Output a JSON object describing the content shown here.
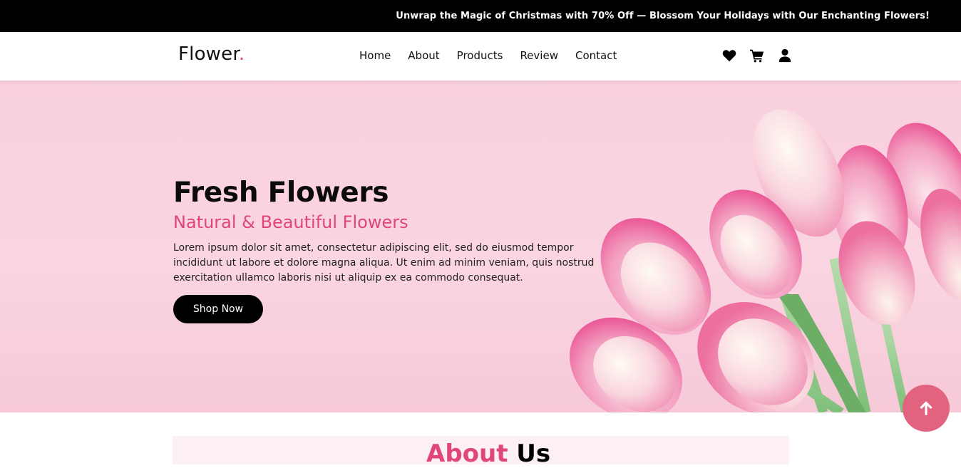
{
  "announcement": "Unwrap the Magic of Christmas with 70% Off — Blossom Your Holidays with Our Enchanting Flowers!",
  "brand": {
    "name": "Flower",
    "dot": ".",
    "accent_color": "#e0457b"
  },
  "nav": {
    "links": [
      "Home",
      "About",
      "Products",
      "Review",
      "Contact"
    ],
    "icons": [
      "heart-icon",
      "cart-icon",
      "user-icon"
    ]
  },
  "hero": {
    "title": "Fresh Flowers",
    "subtitle": "Natural & Beautiful Flowers",
    "description": "Lorem ipsum dolor sit amet, consectetur adipiscing elit, sed do eiusmod tempor incididunt ut labore et dolore magna aliqua. Ut enim ad minim veniam, quis nostrud exercitation ullamco laboris nisi ut aliquip ex ea commodo consequat.",
    "cta": "Shop Now",
    "background_color": "#f9cfdd"
  },
  "about": {
    "heading_part1": "About",
    "heading_part2": " Us"
  },
  "scroll_top": {
    "icon": "arrow-up-icon",
    "color": "#e2637f"
  }
}
